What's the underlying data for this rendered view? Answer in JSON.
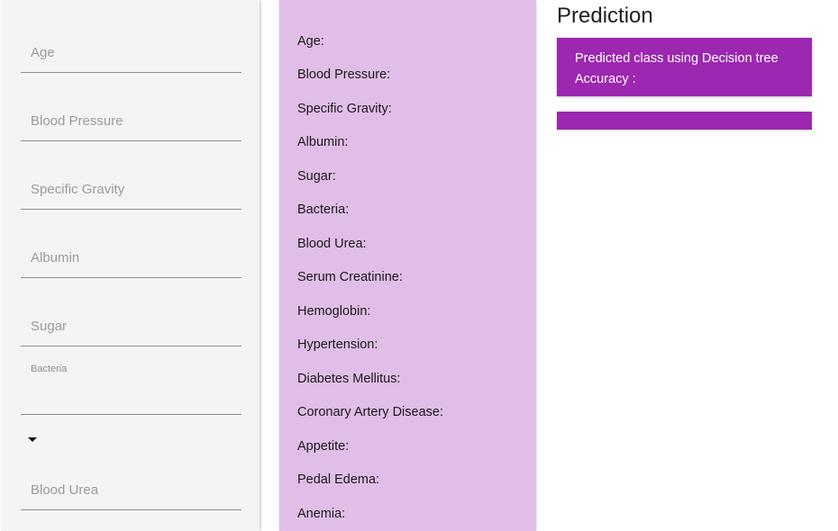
{
  "form": {
    "age_placeholder": "Age",
    "blood_pressure_placeholder": "Blood Pressure",
    "specific_gravity_placeholder": "Specific Gravity",
    "albumin_placeholder": "Albumin",
    "sugar_placeholder": "Sugar",
    "bacteria_label": "Bacteria",
    "blood_urea_placeholder": "Blood Urea"
  },
  "summary": {
    "items": [
      "Age:",
      "Blood Pressure:",
      "Specific Gravity:",
      "Albumin:",
      "Sugar:",
      "Bacteria:",
      "Blood Urea:",
      "Serum Creatinine:",
      "Hemoglobin:",
      "Hypertension:",
      "Diabetes Mellitus:",
      "Coronary Artery Disease:",
      "Appetite:",
      "Pedal Edema:",
      "Anemia:"
    ]
  },
  "prediction": {
    "title": "Prediction",
    "predicted_class_label": "Predicted class using Decision tree",
    "accuracy_label": "Accuracy :"
  },
  "colors": {
    "accent": "#9c27b0",
    "summary_background": "#e1bee7",
    "form_background": "#f4f4f4"
  },
  "icons": {
    "bacteria_dropdown": "caret-down-icon"
  }
}
